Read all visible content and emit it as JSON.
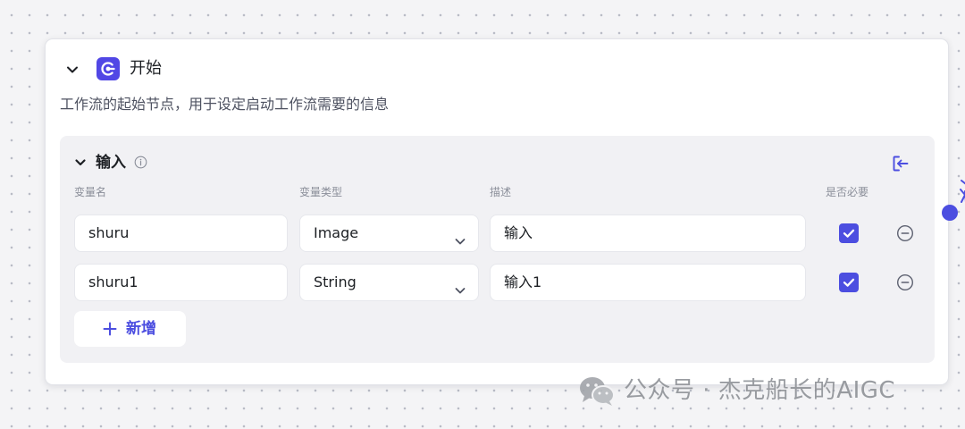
{
  "node": {
    "title": "开始",
    "description": "工作流的起始节点，用于设定启动工作流需要的信息",
    "icon": "start-node-icon",
    "accent_color": "#5147e5"
  },
  "input_section": {
    "title": "输入",
    "columns": {
      "name": "变量名",
      "type": "变量类型",
      "description": "描述",
      "required": "是否必要"
    },
    "rows": [
      {
        "name": "shuru",
        "type": "Image",
        "description": "输入",
        "required": true
      },
      {
        "name": "shuru1",
        "type": "String",
        "description": "输入1",
        "required": true
      }
    ],
    "add_label": "新增"
  },
  "watermark": {
    "text": "公众号 · 杰克船长的AIGC",
    "icon": "wechat-icon"
  },
  "colors": {
    "primary": "#4c4ee0",
    "section_bg": "#f1f1f4",
    "canvas_bg": "#f4f4f6"
  }
}
